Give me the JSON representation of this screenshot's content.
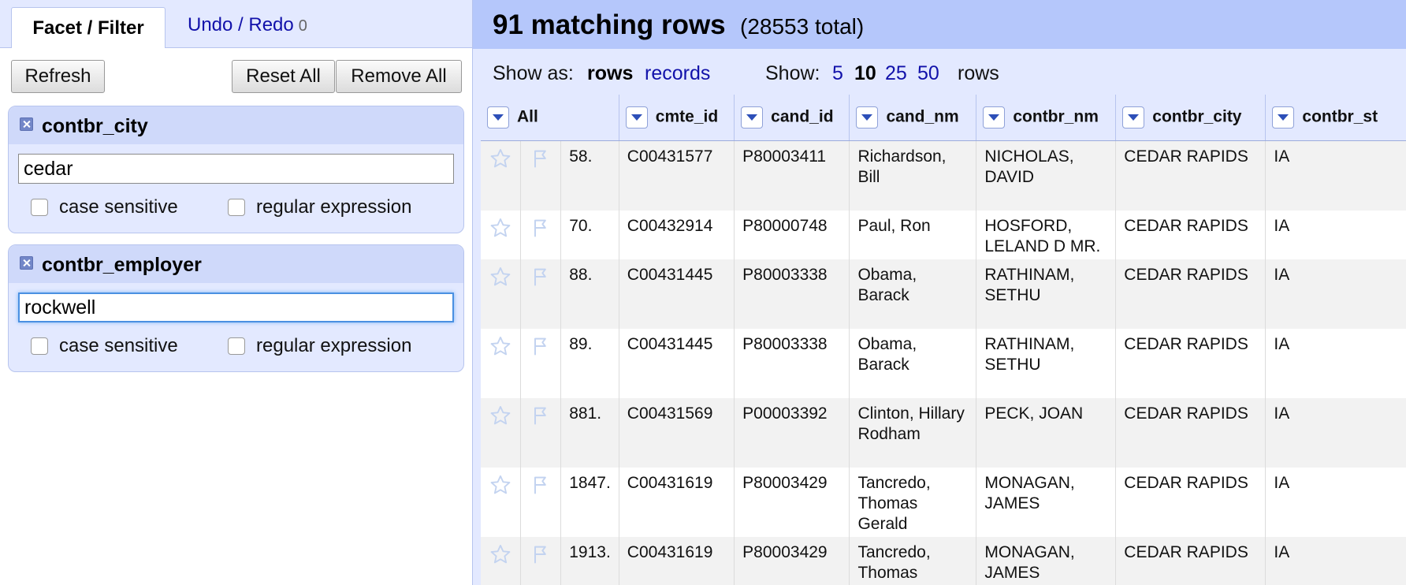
{
  "left_panel": {
    "tabs": {
      "facet_filter": "Facet / Filter",
      "undo_redo": "Undo / Redo",
      "undo_count": "0"
    },
    "buttons": {
      "refresh": "Refresh",
      "reset_all": "Reset All",
      "remove_all": "Remove All"
    },
    "facets": [
      {
        "title": "contbr_city",
        "value": "cedar",
        "case_sensitive_label": "case sensitive",
        "regex_label": "regular expression"
      },
      {
        "title": "contbr_employer",
        "value": "rockwell",
        "case_sensitive_label": "case sensitive",
        "regex_label": "regular expression"
      }
    ]
  },
  "right_panel": {
    "summary": {
      "matching": "91 matching rows",
      "total": "(28553 total)"
    },
    "view_bar": {
      "show_as_label": "Show as:",
      "rows_option": "rows",
      "records_option": "records",
      "show_label": "Show:",
      "page_sizes": [
        "5",
        "10",
        "25",
        "50"
      ],
      "selected_page_size": "10",
      "rows_suffix": "rows"
    },
    "columns": [
      "All",
      "cmte_id",
      "cand_id",
      "cand_nm",
      "contbr_nm",
      "contbr_city",
      "contbr_st"
    ],
    "rows": [
      {
        "index": "58.",
        "cmte_id": "C00431577",
        "cand_id": "P80003411",
        "cand_nm": "Richardson, Bill",
        "contbr_nm": "NICHOLAS, DAVID",
        "contbr_city": "CEDAR RAPIDS",
        "contbr_st": "IA"
      },
      {
        "index": "70.",
        "cmte_id": "C00432914",
        "cand_id": "P80000748",
        "cand_nm": "Paul, Ron",
        "contbr_nm": "HOSFORD, LELAND D MR.",
        "contbr_city": "CEDAR RAPIDS",
        "contbr_st": "IA"
      },
      {
        "index": "88.",
        "cmte_id": "C00431445",
        "cand_id": "P80003338",
        "cand_nm": "Obama, Barack",
        "contbr_nm": "RATHINAM, SETHU",
        "contbr_city": "CEDAR RAPIDS",
        "contbr_st": "IA"
      },
      {
        "index": "89.",
        "cmte_id": "C00431445",
        "cand_id": "P80003338",
        "cand_nm": "Obama, Barack",
        "contbr_nm": "RATHINAM, SETHU",
        "contbr_city": "CEDAR RAPIDS",
        "contbr_st": "IA"
      },
      {
        "index": "881.",
        "cmte_id": "C00431569",
        "cand_id": "P00003392",
        "cand_nm": "Clinton, Hillary Rodham",
        "contbr_nm": "PECK, JOAN",
        "contbr_city": "CEDAR RAPIDS",
        "contbr_st": "IA"
      },
      {
        "index": "1847.",
        "cmte_id": "C00431619",
        "cand_id": "P80003429",
        "cand_nm": "Tancredo, Thomas Gerald",
        "contbr_nm": "MONAGAN, JAMES",
        "contbr_city": "CEDAR RAPIDS",
        "contbr_st": "IA"
      },
      {
        "index": "1913.",
        "cmte_id": "C00431619",
        "cand_id": "P80003429",
        "cand_nm": "Tancredo, Thomas Gerald",
        "contbr_nm": "MONAGAN, JAMES",
        "contbr_city": "CEDAR RAPIDS",
        "contbr_st": "IA"
      }
    ]
  },
  "icons": {
    "star": "star-icon",
    "flag": "flag-icon",
    "dropdown": "dropdown-arrow-icon",
    "close": "close-icon"
  }
}
